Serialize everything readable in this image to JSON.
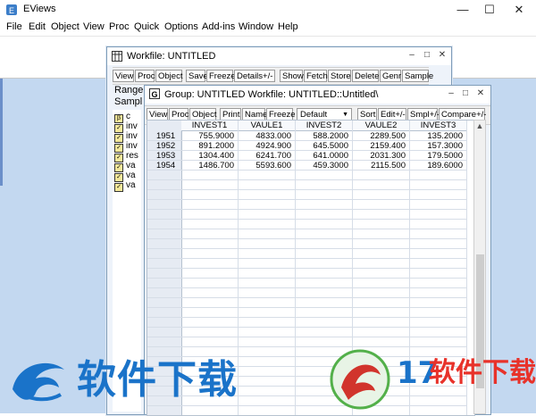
{
  "app": {
    "title": "EViews",
    "controls": [
      "—",
      "☐",
      "✕"
    ]
  },
  "menu": [
    "File",
    "Edit",
    "Object",
    "View",
    "Proc",
    "Quick",
    "Options",
    "Add-ins",
    "Window",
    "Help"
  ],
  "workfile": {
    "title": "Workfile: UNTITLED",
    "toolbar": [
      "View",
      "Proc",
      "Object",
      "Save",
      "Freeze",
      "Details+/-",
      "Show",
      "Fetch",
      "Store",
      "Delete",
      "Genr",
      "Sample"
    ],
    "range_label": "Range",
    "sample_label": "Sampl",
    "objects": [
      {
        "icon": "β",
        "label": "c"
      },
      {
        "icon": "✓",
        "label": "inv"
      },
      {
        "icon": "✓",
        "label": "inv"
      },
      {
        "icon": "✓",
        "label": "inv"
      },
      {
        "icon": "✓",
        "label": "res"
      },
      {
        "icon": "✓",
        "label": "va"
      },
      {
        "icon": "✓",
        "label": "va"
      },
      {
        "icon": "✓",
        "label": "va"
      }
    ]
  },
  "group": {
    "title": "Group: UNTITLED   Workfile: UNTITLED::Untitled\\",
    "icon_letter": "G",
    "toolbar": [
      "View",
      "Proc",
      "Object",
      "Print",
      "Name",
      "Freeze",
      "Sort",
      "Edit+/-",
      "Smpl+/-",
      "Compare+/-"
    ],
    "dropdown": "Default",
    "columns": [
      "INVEST1",
      "VAULE1",
      "INVEST2",
      "VAULE2",
      "INVEST3"
    ],
    "rows": [
      {
        "year": "1951",
        "values": [
          "755.9000",
          "4833.000",
          "588.2000",
          "2289.500",
          "135.2000"
        ]
      },
      {
        "year": "1952",
        "values": [
          "891.2000",
          "4924.900",
          "645.5000",
          "2159.400",
          "157.3000"
        ]
      },
      {
        "year": "1953",
        "values": [
          "1304.400",
          "6241.700",
          "641.0000",
          "2031.300",
          "179.5000"
        ]
      },
      {
        "year": "1954",
        "values": [
          "1486.700",
          "5593.600",
          "459.3000",
          "2115.500",
          "189.6000"
        ]
      }
    ],
    "scroll_up": "▲"
  },
  "watermarks": {
    "left": "软件下载",
    "right_number": "17",
    "right_text": "软件下载"
  },
  "colors": {
    "workspace": "#c3d8f0",
    "watermark_blue": "#1a73c9",
    "watermark_red": "#e8322a"
  }
}
